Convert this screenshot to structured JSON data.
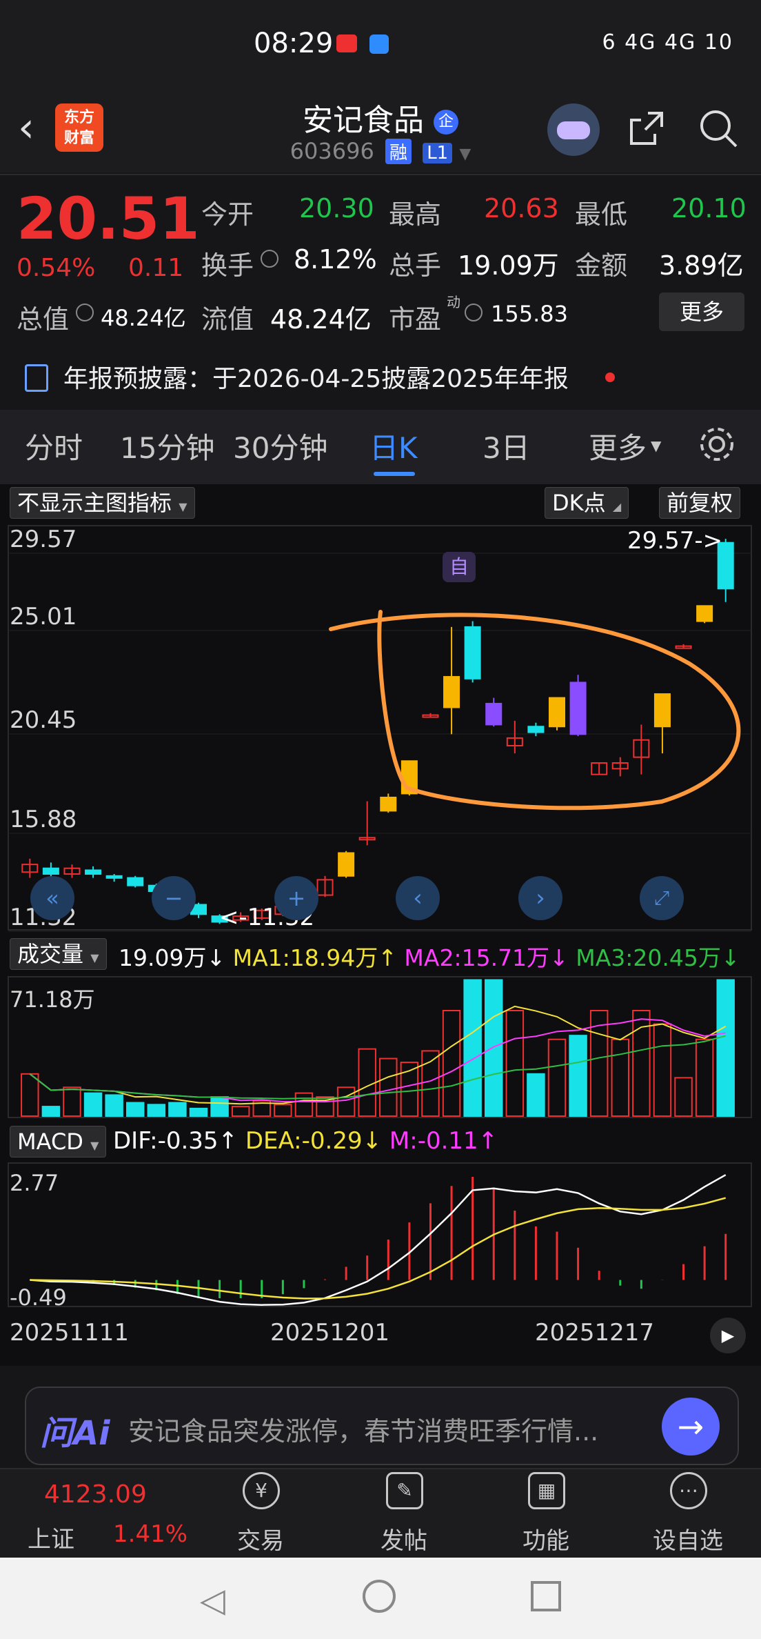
{
  "status": {
    "time": "08:29",
    "icons": "6  4G  4G  10"
  },
  "header": {
    "logo_line1": "东方",
    "logo_line2": "财富",
    "title": "安记食品",
    "title_badge": "企",
    "code": "603696",
    "badge_rong": "融",
    "badge_l1": "L1"
  },
  "quote": {
    "price": "20.51",
    "pct": "0.54%",
    "change": "0.11",
    "open_label": "今开",
    "open": "20.30",
    "high_label": "最高",
    "high": "20.63",
    "low_label": "最低",
    "low": "20.10",
    "turnover_label": "换手",
    "turnover": "8.12%",
    "volume_label": "总手",
    "volume": "19.09万",
    "amount_label": "金额",
    "amount": "3.89亿",
    "mktcap_label": "总值",
    "mktcap": "48.24亿",
    "float_label": "流值",
    "float": "48.24亿",
    "pe_label": "市盈",
    "pe_sup": "动",
    "pe": "155.83",
    "more": "更多"
  },
  "notice": {
    "text": "年报预披露：于2026-04-25披露2025年年报"
  },
  "tabs": [
    "分时",
    "15分钟",
    "30分钟",
    "日K",
    "3日",
    "更多"
  ],
  "chart": {
    "indicator_select": "不显示主图指标",
    "dk_label": "DK点",
    "adjust_label": "前复权",
    "y_ticks": [
      "29.57",
      "25.01",
      "20.45",
      "15.88",
      "11.32"
    ],
    "max_marker": "29.57->",
    "min_marker": "<-11.32",
    "self_marker": "自",
    "volume": {
      "select": "成交量",
      "current": "19.09万↓",
      "ma1": "MA1:18.94万↑",
      "ma2": "MA2:15.71万↓",
      "ma3": "MA3:20.45万↓",
      "ymax": "71.18万"
    },
    "macd": {
      "select": "MACD",
      "dif": "DIF:-0.35↑",
      "dea": "DEA:-0.29↓",
      "m": "M:-0.11↑",
      "ymax": "2.77",
      "ymin": "-0.49"
    },
    "dates": [
      "20251111",
      "20251201",
      "20251217"
    ],
    "colors": {
      "up": "#ef3030",
      "down": "#18e1e8",
      "yellow": "#f7b500",
      "purple": "#8a4dff"
    }
  },
  "chart_data": {
    "type": "candlestick",
    "ylim": [
      11.32,
      29.57
    ],
    "candles": [
      {
        "o": 12.2,
        "c": 12.6,
        "h": 12.9,
        "l": 11.9,
        "up": true
      },
      {
        "o": 12.4,
        "c": 12.1,
        "h": 12.7,
        "l": 11.8,
        "up": false
      },
      {
        "o": 12.1,
        "c": 12.4,
        "h": 12.6,
        "l": 11.9,
        "up": true
      },
      {
        "o": 12.3,
        "c": 12.1,
        "h": 12.5,
        "l": 11.9,
        "up": false
      },
      {
        "o": 12.0,
        "c": 11.9,
        "h": 12.1,
        "l": 11.7,
        "up": false
      },
      {
        "o": 11.9,
        "c": 11.5,
        "h": 12.0,
        "l": 11.4,
        "up": false
      },
      {
        "o": 11.5,
        "c": 11.2,
        "h": 11.6,
        "l": 11.0,
        "up": false
      },
      {
        "o": 11.2,
        "c": 10.6,
        "h": 11.3,
        "l": 10.3,
        "up": false
      },
      {
        "o": 10.5,
        "c": 10.0,
        "h": 10.6,
        "l": 9.8,
        "up": false
      },
      {
        "o": 9.9,
        "c": 9.6,
        "h": 10.0,
        "l": 9.5,
        "up": false
      },
      {
        "o": 9.7,
        "c": 9.9,
        "h": 10.1,
        "l": 9.6,
        "up": true
      },
      {
        "o": 9.8,
        "c": 10.2,
        "h": 10.3,
        "l": 9.7,
        "up": true
      },
      {
        "o": 10.0,
        "c": 10.4,
        "h": 10.5,
        "l": 9.9,
        "up": true
      },
      {
        "o": 10.3,
        "c": 10.9,
        "h": 11.1,
        "l": 10.2,
        "up": true
      },
      {
        "o": 11.0,
        "c": 11.8,
        "h": 12.0,
        "l": 10.9,
        "up": true
      },
      {
        "o": 12.0,
        "c": 13.2,
        "h": 13.3,
        "l": 11.9,
        "up": true,
        "y": true
      },
      {
        "o": 14.0,
        "c": 14.0,
        "h": 15.9,
        "l": 13.6,
        "up": true
      },
      {
        "o": 15.4,
        "c": 16.1,
        "h": 16.3,
        "l": 15.3,
        "up": true,
        "y": true
      },
      {
        "o": 16.3,
        "c": 18.0,
        "h": 18.0,
        "l": 16.2,
        "up": true,
        "y": true
      },
      {
        "o": 20.4,
        "c": 20.4,
        "h": 20.5,
        "l": 20.3,
        "up": true
      },
      {
        "o": 20.8,
        "c": 22.4,
        "h": 25.0,
        "l": 19.4,
        "up": true,
        "y": true
      },
      {
        "o": 22.3,
        "c": 25.0,
        "h": 25.3,
        "l": 22.1,
        "up": false
      },
      {
        "o": 21.0,
        "c": 19.9,
        "h": 21.3,
        "l": 19.8,
        "up": false,
        "p": true
      },
      {
        "o": 19.2,
        "c": 18.8,
        "h": 20.1,
        "l": 18.4,
        "up": true
      },
      {
        "o": 19.8,
        "c": 19.5,
        "h": 20.0,
        "l": 19.3,
        "up": false
      },
      {
        "o": 19.8,
        "c": 21.3,
        "h": 21.3,
        "l": 19.6,
        "up": true,
        "y": true
      },
      {
        "o": 22.1,
        "c": 19.4,
        "h": 22.5,
        "l": 19.3,
        "up": false,
        "p": true
      },
      {
        "o": 17.9,
        "c": 17.3,
        "h": 17.9,
        "l": 17.3,
        "up": true
      },
      {
        "o": 17.9,
        "c": 17.6,
        "h": 18.2,
        "l": 17.2,
        "up": true
      },
      {
        "o": 18.2,
        "c": 19.1,
        "h": 19.9,
        "l": 17.3,
        "up": true
      },
      {
        "o": 19.8,
        "c": 21.5,
        "h": 21.5,
        "l": 18.4,
        "up": true,
        "y": true
      },
      {
        "o": 24.0,
        "c": 24.0,
        "h": 24.1,
        "l": 23.9,
        "up": true
      },
      {
        "o": 25.3,
        "c": 26.1,
        "h": 26.1,
        "l": 25.2,
        "up": true,
        "y": true
      },
      {
        "o": 29.4,
        "c": 27.0,
        "h": 29.6,
        "l": 26.3,
        "up": false
      }
    ],
    "volume": [
      22,
      5,
      15,
      12,
      11,
      7,
      6,
      7,
      4,
      10,
      5,
      8,
      6,
      12,
      10,
      15,
      35,
      30,
      28,
      34,
      55,
      71,
      71,
      55,
      22,
      40,
      42,
      55,
      40,
      55,
      48,
      20,
      40,
      71
    ]
  }
}
